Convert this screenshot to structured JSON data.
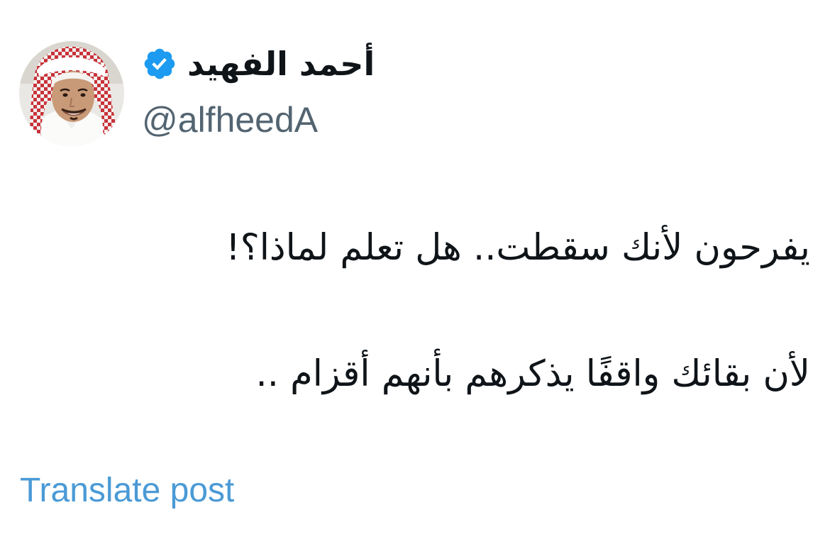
{
  "author": {
    "display_name": "أحمد الفهيد",
    "handle": "@alfheedA",
    "verified": true,
    "verified_icon": "verified-badge-icon",
    "avatar_icon": "profile-photo"
  },
  "post": {
    "lines": [
      "يفرحون لأنك سقطت.. هل تعلم لماذا؟!",
      "لأن بقائك واقفًا يذكرهم بأنهم أقزام .."
    ]
  },
  "actions": {
    "translate_label": "Translate post"
  },
  "colors": {
    "text": "#0f1419",
    "secondary_text": "#536471",
    "link": "#4a9ad6",
    "verified": "#1d9bf0",
    "background": "#ffffff"
  }
}
